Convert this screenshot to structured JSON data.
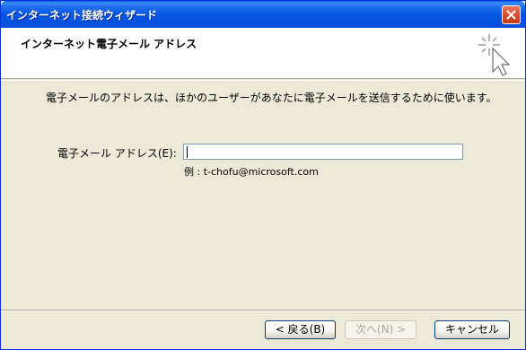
{
  "window": {
    "title": "インターネット接続ウィザード"
  },
  "header": {
    "title": "インターネット電子メール アドレス",
    "icon": "wizard-sparkle-cursor-icon"
  },
  "body": {
    "description": "電子メールのアドレスは、ほかのユーザーがあなたに電子メールを送信するために使います。",
    "email_label": "電子メール アドレス(E):",
    "email_value": "",
    "example": "例 : t-chofu@microsoft.com"
  },
  "buttons": {
    "back": "< 戻る(B)",
    "next": "次へ(N) >",
    "cancel": "キャンセル"
  },
  "colors": {
    "titlebar": "#0655E3",
    "dialog_bg": "#ECE9D8",
    "close": "#D6502E"
  }
}
